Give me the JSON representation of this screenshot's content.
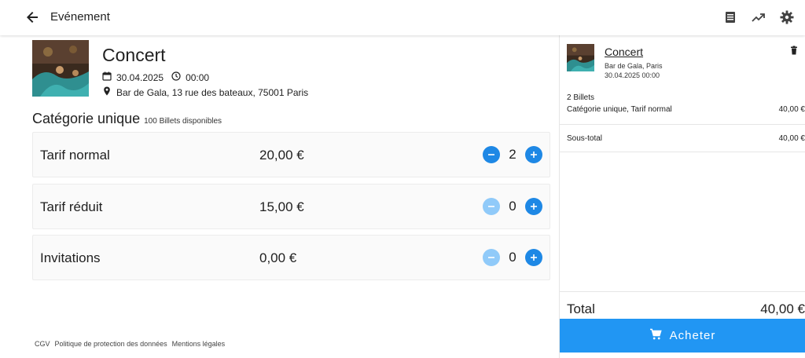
{
  "header": {
    "title": "Evénement",
    "icons": [
      "back-arrow-icon",
      "list-icon",
      "trending-up-icon",
      "settings-gear-icon"
    ]
  },
  "event": {
    "title": "Concert",
    "date": "30.04.2025",
    "time": "00:00",
    "address": "Bar de Gala, 13 rue des bateaux, 75001 Paris"
  },
  "category": {
    "title": "Catégorie unique",
    "availability": "100 Billets disponibles"
  },
  "tickets": [
    {
      "name": "Tarif normal",
      "price": "20,00 €",
      "qty": "2",
      "minus_disabled": false
    },
    {
      "name": "Tarif réduit",
      "price": "15,00 €",
      "qty": "0",
      "minus_disabled": true
    },
    {
      "name": "Invitations",
      "price": "0,00 €",
      "qty": "0",
      "minus_disabled": true
    }
  ],
  "footer": {
    "links": [
      "CGV",
      "Politique de protection des données",
      "Mentions légales"
    ]
  },
  "cart": {
    "title": "Concert",
    "venue": "Bar de Gala, Paris",
    "datetime": "30.04.2025 00:00",
    "count": "2 Billets",
    "line_label": "Catégorie unique, Tarif normal",
    "line_amount": "40,00 €",
    "subtotal_label": "Sous-total",
    "subtotal_amount": "40,00 €",
    "total_label": "Total",
    "total_amount": "40,00 €",
    "buy_label": "Acheter"
  },
  "colors": {
    "accent": "#2196f3",
    "button_blue": "#1e88e5",
    "button_disabled": "#90caf9"
  }
}
